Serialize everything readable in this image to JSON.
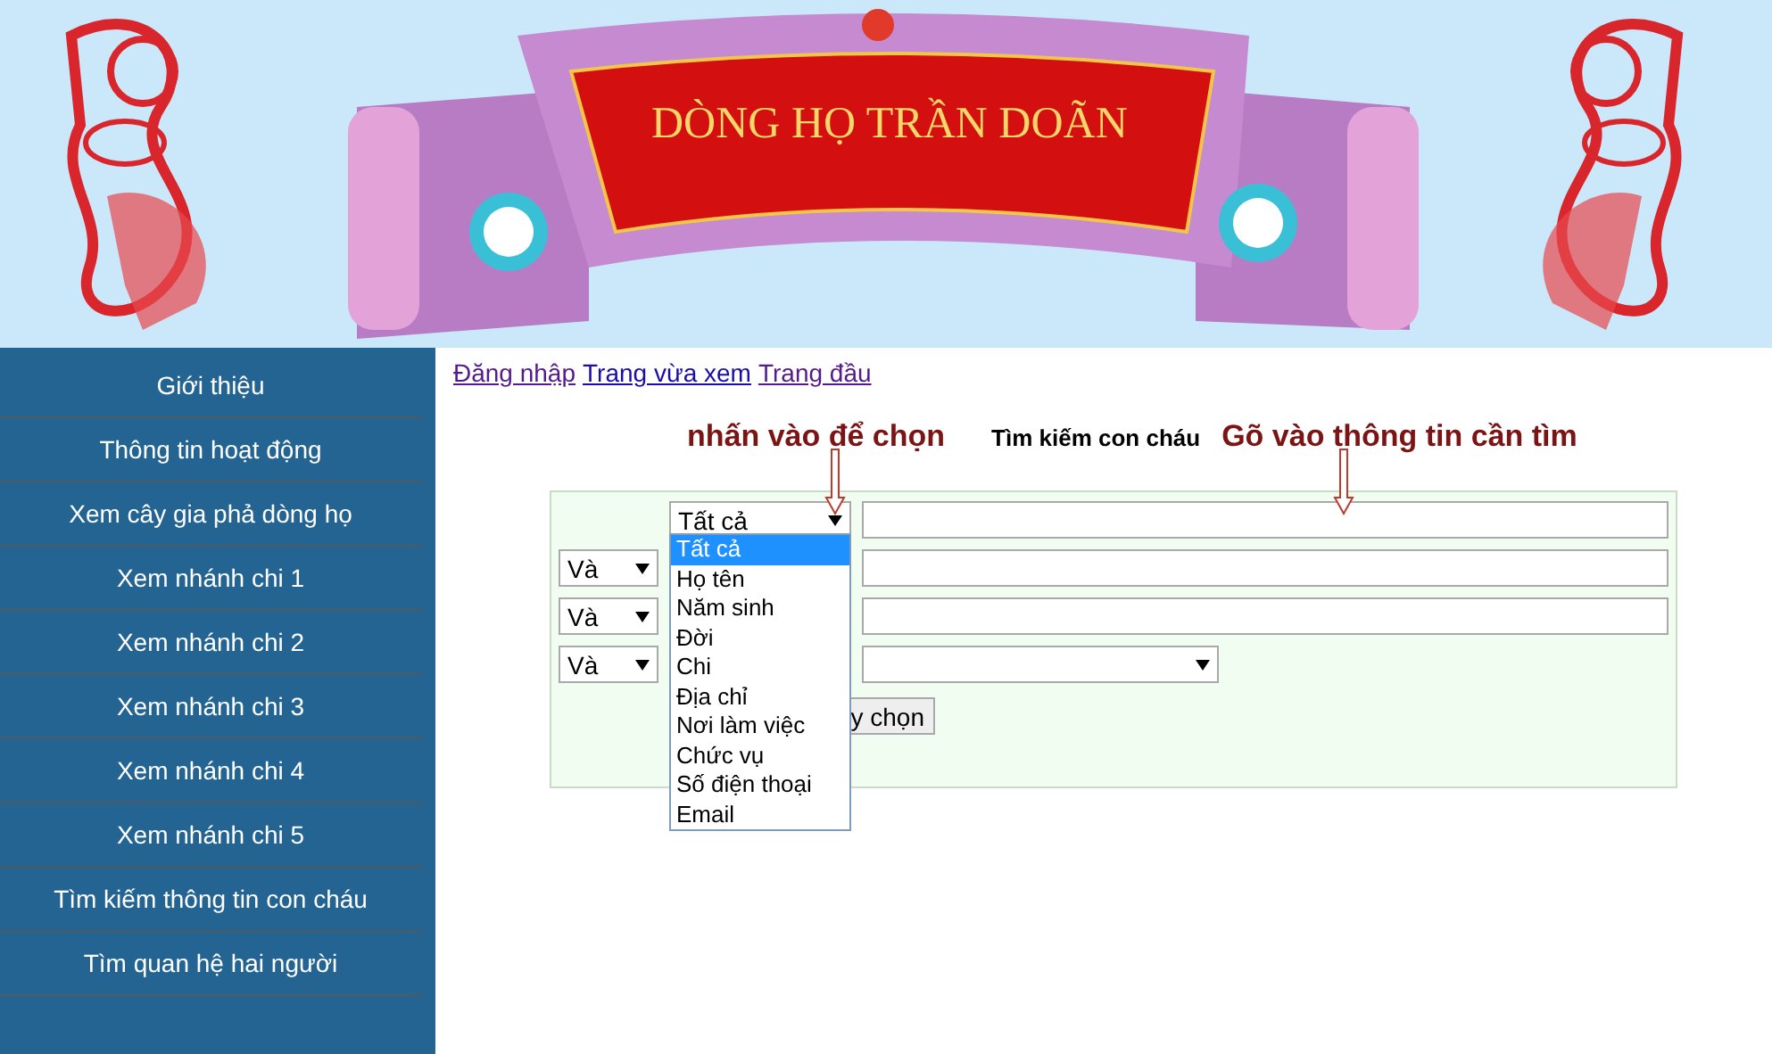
{
  "header": {
    "title": "DÒNG HỌ TRẦN DOÃN"
  },
  "sidebar": {
    "items": [
      {
        "label": "Giới thiệu"
      },
      {
        "label": "Thông tin hoạt động"
      },
      {
        "label": "Xem cây gia phả dòng họ"
      },
      {
        "label": "Xem nhánh chi 1"
      },
      {
        "label": "Xem nhánh chi 2"
      },
      {
        "label": "Xem nhánh chi 3"
      },
      {
        "label": "Xem nhánh chi 4"
      },
      {
        "label": "Xem nhánh chi 5"
      },
      {
        "label": "Tìm kiếm thông tin con cháu"
      },
      {
        "label": "Tìm quan hệ hai người"
      }
    ]
  },
  "links": [
    {
      "label": "Đăng nhập",
      "visited": true
    },
    {
      "label": "Trang vừa xem",
      "visited": false
    },
    {
      "label": "Trang đầu",
      "visited": true
    }
  ],
  "annotations": [
    {
      "text": "nhấn vào để chọn"
    },
    {
      "text": "Gõ vào thông tin cần tìm"
    }
  ],
  "search_title": "Tìm kiếm con cháu",
  "form": {
    "rows": [
      {
        "field": "Tất cả",
        "kind": "text"
      },
      {
        "operator": "Và",
        "kind": "text"
      },
      {
        "operator": "Và",
        "kind": "text"
      },
      {
        "operator": "Và",
        "kind": "select"
      }
    ],
    "button": {
      "label": "y chọn"
    }
  },
  "dropdown": {
    "options": [
      {
        "label": "Tất cả",
        "selected": true
      },
      {
        "label": "Họ tên",
        "selected": false
      },
      {
        "label": "Năm sinh",
        "selected": false
      },
      {
        "label": "Đời",
        "selected": false
      },
      {
        "label": "Chi",
        "selected": false
      },
      {
        "label": "Địa chỉ",
        "selected": false
      },
      {
        "label": "Nơi làm việc",
        "selected": false
      },
      {
        "label": "Chức vụ",
        "selected": false
      },
      {
        "label": "Số điện thoại",
        "selected": false
      },
      {
        "label": "Email",
        "selected": false
      }
    ]
  }
}
